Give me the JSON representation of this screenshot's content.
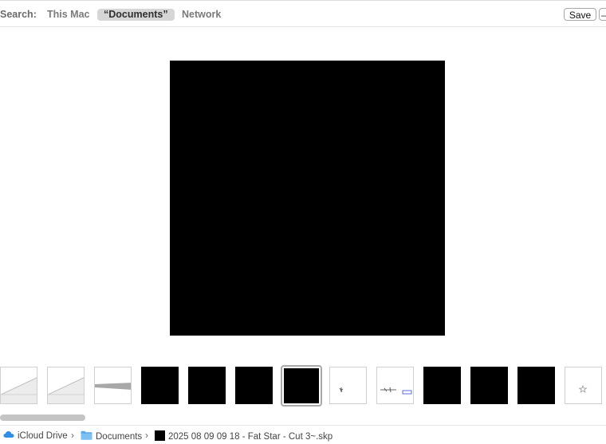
{
  "search": {
    "label": "Search:",
    "scopes": [
      "This Mac",
      "“Documents”",
      "Network"
    ],
    "selected_scope": "“Documents”"
  },
  "toolbar": {
    "save_label": "Save",
    "minus_label": "–"
  },
  "preview": {
    "icon": "black-square-preview"
  },
  "filmstrip": {
    "thumbnails": [
      {
        "kind": "gray-wedge"
      },
      {
        "kind": "gray-wedge"
      },
      {
        "kind": "gray-bar"
      },
      {
        "kind": "black"
      },
      {
        "kind": "black"
      },
      {
        "kind": "black"
      },
      {
        "kind": "black",
        "selected": true
      },
      {
        "kind": "small-sketch"
      },
      {
        "kind": "line-sketch"
      },
      {
        "kind": "black"
      },
      {
        "kind": "black"
      },
      {
        "kind": "black"
      },
      {
        "kind": "star"
      }
    ]
  },
  "pathbar": {
    "items": [
      "iCloud Drive",
      "Documents",
      "2025 08 09  09 18 - Fat Star - Cut 3~.skp"
    ],
    "separator": "›",
    "icons": [
      "cloud-icon",
      "folder-icon",
      "file-thumbnail-icon"
    ],
    "colors": {
      "cloud": "#2f8fe6",
      "folder": "#5aa9ea"
    }
  },
  "colors": {
    "background": "#ffffff",
    "scope_selected_bg": "#d6d6d6",
    "preview": "#000000"
  }
}
